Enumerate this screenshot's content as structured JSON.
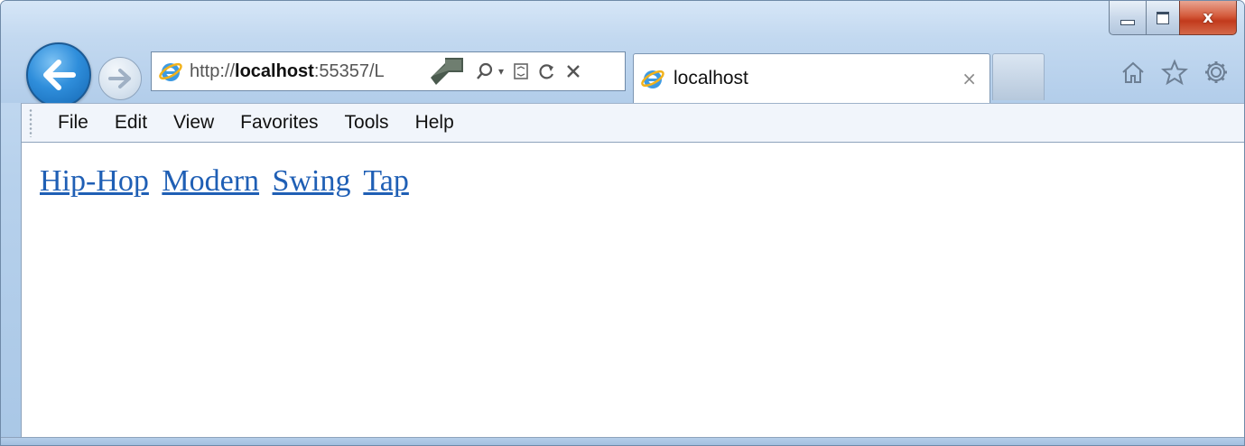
{
  "window": {
    "controls": {
      "minimize": "minimize-icon",
      "maximize": "maximize-icon",
      "close": "x"
    }
  },
  "nav": {
    "back": "back-arrow-icon",
    "forward": "forward-arrow-icon"
  },
  "address": {
    "prefix": "http://",
    "host": "localhost",
    "rest": ":55357/L",
    "icons": [
      "search-icon",
      "dropdown-arrow-icon",
      "compatibility-icon",
      "refresh-icon",
      "stop-icon"
    ]
  },
  "tab": {
    "title": "localhost",
    "close": "×"
  },
  "toolbar_icons": [
    "home-icon",
    "favorites-star-icon",
    "settings-gear-icon"
  ],
  "menu": {
    "items": [
      "File",
      "Edit",
      "View",
      "Favorites",
      "Tools",
      "Help"
    ]
  },
  "page": {
    "links": [
      "Hip-Hop",
      "Modern",
      "Swing",
      "Tap"
    ]
  },
  "colors": {
    "link": "#1f5fb5",
    "chrome": "#b7d1ec",
    "close_button": "#c23a1c"
  }
}
